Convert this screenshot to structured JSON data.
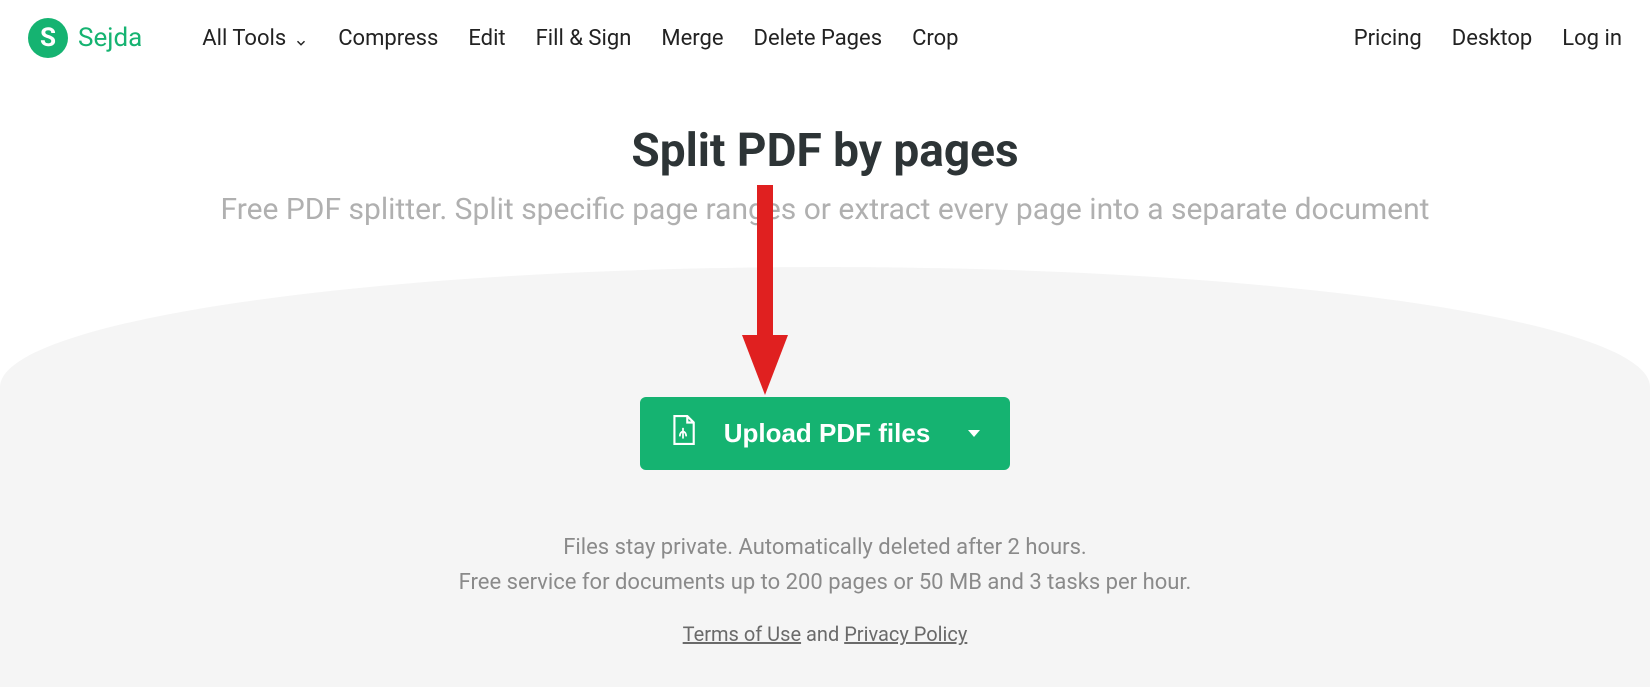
{
  "brand": {
    "logo_letter": "S",
    "name": "Sejda"
  },
  "nav": {
    "all_tools": "All Tools",
    "compress": "Compress",
    "edit": "Edit",
    "fill_sign": "Fill & Sign",
    "merge": "Merge",
    "delete_pages": "Delete Pages",
    "crop": "Crop"
  },
  "nav_right": {
    "pricing": "Pricing",
    "desktop": "Desktop",
    "login": "Log in"
  },
  "hero": {
    "title": "Split PDF by pages",
    "subtitle": "Free PDF splitter. Split specific page ranges or extract every page into a separate document"
  },
  "upload": {
    "button_label": "Upload PDF files"
  },
  "notes": {
    "line1": "Files stay private. Automatically deleted after 2 hours.",
    "line2": "Free service for documents up to 200 pages or 50 MB and 3 tasks per hour."
  },
  "legal": {
    "terms": "Terms of Use",
    "and": " and ",
    "privacy": "Privacy Policy"
  },
  "colors": {
    "accent": "#15b371",
    "annotation_arrow": "#e02020"
  }
}
